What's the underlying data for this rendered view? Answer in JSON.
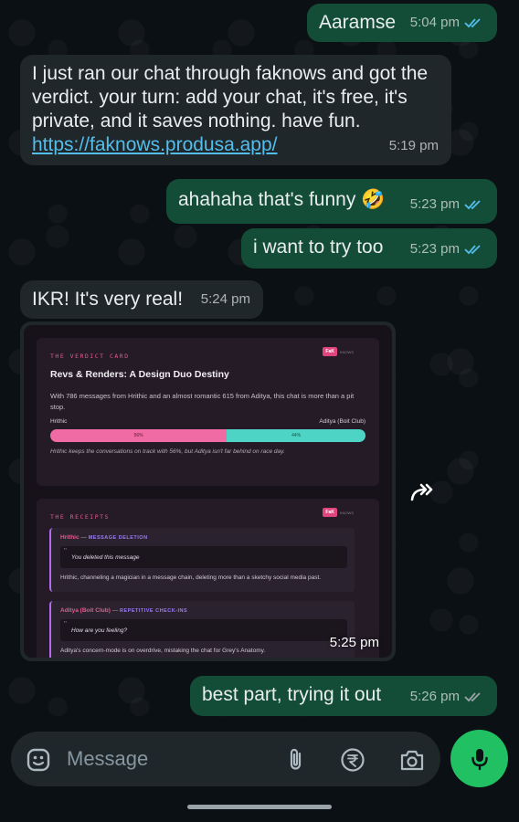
{
  "messages": [
    {
      "text": "Aaramse",
      "time": "5:04 pm"
    },
    {
      "text": "I just ran our chat through faknows and got the verdict. your turn: add your chat, it's free, it's private, and it saves nothing. have fun.",
      "link": "https://faknows.produsa.app/",
      "time": "5:19 pm"
    },
    {
      "text": "ahahaha that's funny 🤣",
      "time": "5:23 pm"
    },
    {
      "text": "i want to try too",
      "time": "5:23 pm"
    },
    {
      "text": "IKR! It's very real!",
      "time": "5:24 pm"
    },
    {
      "time": "5:25 pm"
    },
    {
      "text": "best part, trying it out",
      "time": "5:26 pm"
    }
  ],
  "verdict_card": {
    "header": "THE VERDICT CARD",
    "badge": "FaK",
    "badge_text": "KNOWS",
    "title": "Revs & Renders: A Design Duo Destiny",
    "description": "With 786 messages from Hrithic and an almost romantic 615 from Aditya, this chat is more than a pit stop.",
    "left_name": "Hrithic",
    "right_name": "Aditya (Boit Club)",
    "left_pct": 56,
    "right_pct": 44,
    "left_pct_label": "56%",
    "right_pct_label": "44%",
    "left_color": "#f06aa3",
    "right_color": "#4dd4c4",
    "note": "Hrithic keeps the conversations on track with 56%, but Aditya isn't far behind on race day."
  },
  "receipts_card": {
    "header": "THE RECEIPTS",
    "badge": "FaK",
    "badge_text": "KNOWS",
    "items": [
      {
        "name": "Hrithic",
        "tag": "MESSAGE DELETION",
        "quote": "You deleted this message",
        "comment": "Hrithic, channeling a magician in a message chain, deleting more than a sketchy social media past."
      },
      {
        "name": "Aditya (Boit Club)",
        "tag": "REPETITIVE CHECK-INS",
        "quote": "How are you feeling?",
        "comment": "Aditya's concern-mode is on overdrive, mistaking the chat for Grey's Anatomy."
      }
    ]
  },
  "input": {
    "placeholder": "Message"
  },
  "icons": {
    "emoji": "emoji-icon",
    "attach": "paperclip-icon",
    "payment": "rupee-icon",
    "camera": "camera-icon",
    "mic": "mic-icon",
    "forward": "forward-icon",
    "read_ticks": "double-check-icon"
  },
  "colors": {
    "outgoing_bubble": "#144d37",
    "incoming_bubble": "#1f272a",
    "mic_button": "#21c063",
    "link": "#53bdeb",
    "read_ticks": "#53bdeb"
  }
}
